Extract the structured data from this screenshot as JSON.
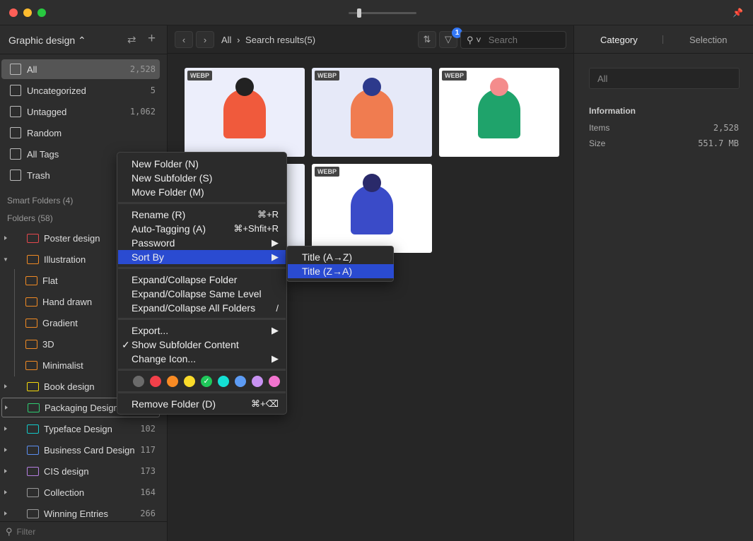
{
  "window": {
    "close": "#fe5f57",
    "minimize": "#febc2e",
    "maximize": "#28c840"
  },
  "sidebar": {
    "library": "Graphic design",
    "items": [
      {
        "label": "All",
        "count": "2,528",
        "icon": "archive-icon"
      },
      {
        "label": "Uncategorized",
        "count": "5",
        "icon": "question-icon"
      },
      {
        "label": "Untagged",
        "count": "1,062",
        "icon": "untagged-icon"
      },
      {
        "label": "Random",
        "count": "",
        "icon": "lightbulb-icon"
      },
      {
        "label": "All Tags",
        "count": "",
        "icon": "tags-icon"
      },
      {
        "label": "Trash",
        "count": "",
        "icon": "trash-icon"
      }
    ],
    "smart_folders": "Smart Folders (4)",
    "folders_header": "Folders (58)",
    "folders": [
      {
        "label": "Poster design",
        "count": "",
        "color": "#e5484d",
        "level": 0,
        "expanded": false
      },
      {
        "label": "Illustration",
        "count": "",
        "color": "#f08a24",
        "level": 0,
        "expanded": true
      },
      {
        "label": "Flat",
        "count": "",
        "color": "#f08a24",
        "level": 1
      },
      {
        "label": "Hand drawn",
        "count": "",
        "color": "#f08a24",
        "level": 1
      },
      {
        "label": "Gradient",
        "count": "",
        "color": "#f08a24",
        "level": 1
      },
      {
        "label": "3D",
        "count": "",
        "color": "#f08a24",
        "level": 1
      },
      {
        "label": "Minimalist",
        "count": "",
        "color": "#f08a24",
        "level": 1
      },
      {
        "label": "Book design",
        "count": "",
        "color": "#f5d90a",
        "level": 0,
        "expanded": false
      },
      {
        "label": "Packaging Design",
        "count": "",
        "color": "#2ecc71",
        "level": 0,
        "expanded": false
      },
      {
        "label": "Typeface Design",
        "count": "102",
        "color": "#12c9c9",
        "level": 0,
        "expanded": false
      },
      {
        "label": "Business Card Design",
        "count": "117",
        "color": "#5b8def",
        "level": 0,
        "expanded": false
      },
      {
        "label": "CIS design",
        "count": "173",
        "color": "#b57ee0",
        "level": 0,
        "expanded": false
      },
      {
        "label": "Collection",
        "count": "164",
        "color": "#999999",
        "level": 0,
        "expanded": false
      },
      {
        "label": "Winning Entries",
        "count": "266",
        "color": "#999999",
        "level": 0,
        "expanded": false
      }
    ],
    "filter_placeholder": "Filter"
  },
  "toolbar": {
    "breadcrumb_root": "All",
    "breadcrumb_current": "Search results(5)",
    "filter_badge": "1",
    "search_placeholder": "Search"
  },
  "thumbnails": [
    {
      "badge": "WEBP"
    },
    {
      "badge": "WEBP"
    },
    {
      "badge": "WEBP"
    },
    {
      "badge": "WEBP"
    },
    {
      "badge": "WEBP"
    }
  ],
  "right": {
    "tabs": [
      "Category",
      "Selection"
    ],
    "category_value": "All",
    "info_title": "Information",
    "items_label": "Items",
    "items_value": "2,528",
    "size_label": "Size",
    "size_value": "551.7 MB"
  },
  "menu": {
    "g1": [
      "New Folder (N)",
      "New Subfolder (S)",
      "Move Folder (M)"
    ],
    "rename": "Rename (R)",
    "rename_sc": "⌘+R",
    "autotag": "Auto-Tagging (A)",
    "autotag_sc": "⌘+Shfit+R",
    "password": "Password",
    "sortby": "Sort By",
    "g3": [
      "Expand/Collapse Folder",
      "Expand/Collapse Same Level",
      "Expand/Collapse All Folders"
    ],
    "g3_sc": "/",
    "export": "Export...",
    "show_sub": "Show Subfolder Content",
    "change_icon": "Change Icon...",
    "colors": [
      "#6b6b6b",
      "#f2404a",
      "#f98b24",
      "#fadb2a",
      "#1fc85a",
      "#14e0d4",
      "#5d9cf5",
      "#c892f2",
      "#f274cf"
    ],
    "selected_color": 4,
    "remove": "Remove Folder (D)",
    "remove_sc": "⌘+⌫",
    "submenu": [
      "Title (A→Z)",
      "Title (Z→A)"
    ],
    "submenu_selected": 1
  }
}
